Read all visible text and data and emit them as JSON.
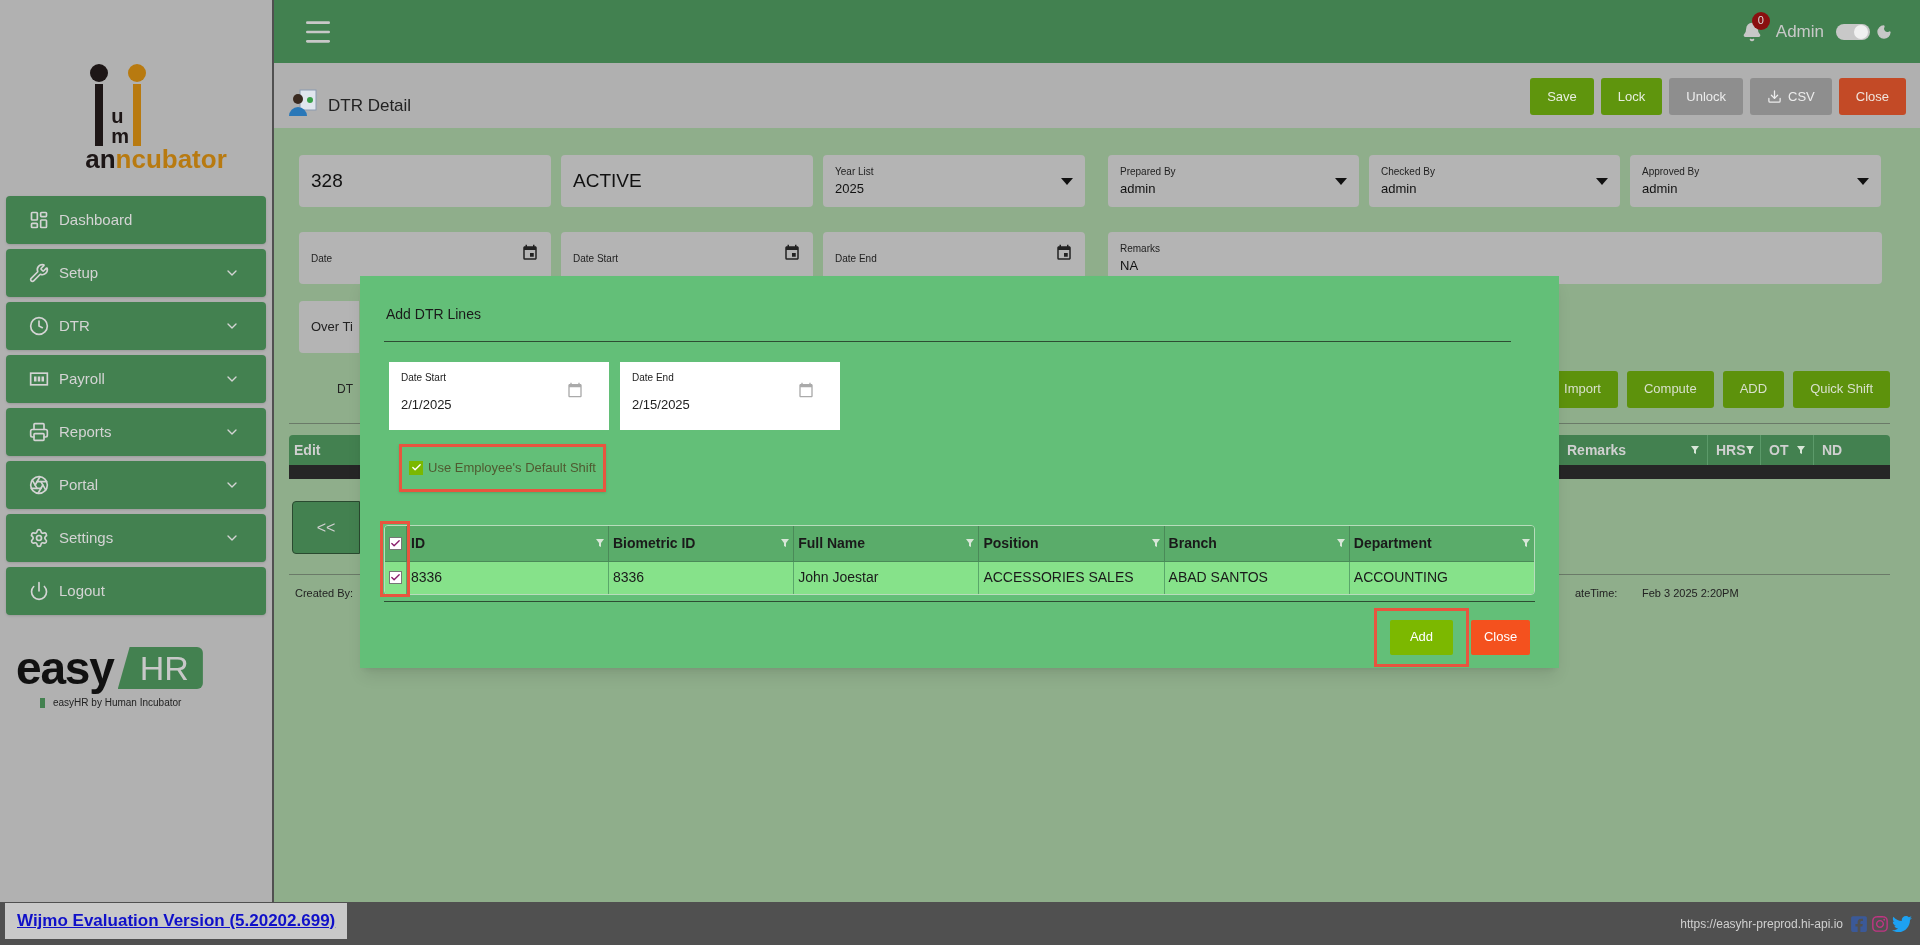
{
  "header": {
    "notifications": "0",
    "user": "Admin",
    "dark_mode": true
  },
  "sidebar": {
    "logo": {
      "stem": "um",
      "base": "an",
      "word": "ncubator"
    },
    "items": [
      {
        "label": "Dashboard",
        "kind": "dashboard",
        "expandable": false
      },
      {
        "label": "Setup",
        "kind": "setup",
        "expandable": true
      },
      {
        "label": "DTR",
        "kind": "dtr",
        "expandable": true
      },
      {
        "label": "Payroll",
        "kind": "payroll",
        "expandable": true
      },
      {
        "label": "Reports",
        "kind": "reports",
        "expandable": true
      },
      {
        "label": "Portal",
        "kind": "portal",
        "expandable": true
      },
      {
        "label": "Settings",
        "kind": "settings",
        "expandable": true
      },
      {
        "label": "Logout",
        "kind": "logout",
        "expandable": false
      }
    ],
    "brand": {
      "word": "easy",
      "tag": "HR",
      "caption": "easyHR by Human Incubator"
    }
  },
  "page": {
    "title": "DTR Detail",
    "toolbar": [
      {
        "label": "Save",
        "kind": "ok",
        "disabled": false
      },
      {
        "label": "Lock",
        "kind": "ok",
        "disabled": false
      },
      {
        "label": "Unlock",
        "kind": "plain",
        "disabled": true
      },
      {
        "label": "CSV",
        "kind": "download",
        "disabled": true
      },
      {
        "label": "Close",
        "kind": "danger",
        "disabled": false
      }
    ],
    "fields_row1": [
      {
        "value": "328",
        "kind": "text"
      },
      {
        "value": "ACTIVE",
        "kind": "text"
      },
      {
        "label": "Year List",
        "value": "2025",
        "kind": "select"
      }
    ],
    "fields_row1_right": [
      {
        "label": "Prepared By",
        "value": "admin",
        "kind": "select"
      },
      {
        "label": "Checked By",
        "value": "admin",
        "kind": "select"
      },
      {
        "label": "Approved By",
        "value": "admin",
        "kind": "select"
      }
    ],
    "fields_row2": [
      {
        "label": "Date",
        "kind": "date"
      },
      {
        "label": "Date Start",
        "kind": "date"
      },
      {
        "label": "Date End",
        "kind": "date"
      }
    ],
    "remarks": {
      "label": "Remarks",
      "value": "NA"
    },
    "overtime": {
      "label": "Over Ti"
    },
    "tab": "DT",
    "actions": [
      "Import",
      "Compute",
      "ADD",
      "Quick Shift"
    ],
    "grid": {
      "left_column": "Edit",
      "right_columns": [
        "Remarks",
        "HRS",
        "OT",
        "ND"
      ]
    },
    "pager": "<<",
    "created_by": "Created By:",
    "datetime": {
      "label": "ateTime:",
      "value": "Feb 3 2025 2:20PM"
    }
  },
  "dialog": {
    "title": "Add DTR Lines",
    "dates": [
      {
        "label": "Date Start",
        "value": "2/1/2025"
      },
      {
        "label": "Date End",
        "value": "2/15/2025"
      }
    ],
    "default_shift": {
      "label": "Use Employee's Default Shift",
      "checked": true
    },
    "table": {
      "select_all": true,
      "columns": [
        "ID",
        "Biometric ID",
        "Full Name",
        "Position",
        "Branch",
        "Department"
      ],
      "rows": [
        {
          "checked": true,
          "cells": [
            "8336",
            "8336",
            "John Joestar",
            "ACCESSORIES SALES",
            "ABAD SANTOS",
            "ACCOUNTING"
          ]
        }
      ]
    },
    "buttons": [
      {
        "label": "Add",
        "kind": "ok"
      },
      {
        "label": "Close",
        "kind": "danger"
      }
    ]
  },
  "footer": {
    "notice": "Wijmo Evaluation Version (5.20202.699)",
    "url": "https://easyhr-preprod.hi-api.io"
  }
}
